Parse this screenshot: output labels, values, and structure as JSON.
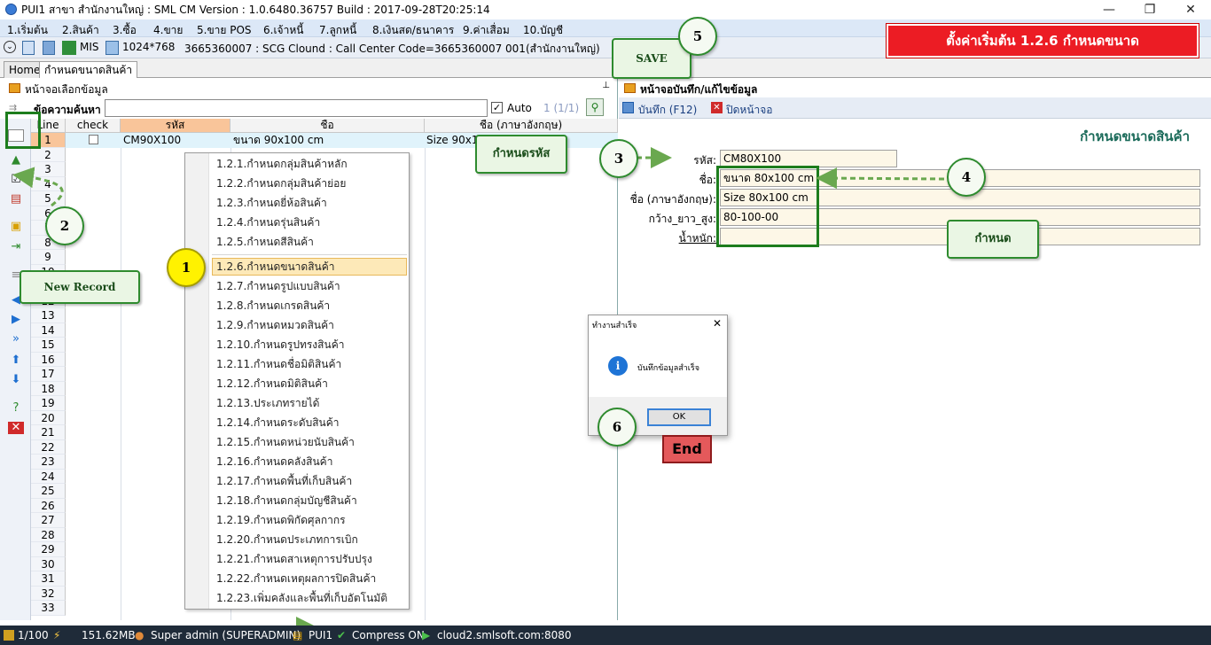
{
  "window": {
    "title": "PUI1 สาขา สำนักงานใหญ่ : SML CM Version : 1.0.6480.36757  Build : 2017-09-28T20:25:14",
    "minimize": "—",
    "maximize": "❐",
    "close": "✕"
  },
  "menu": [
    "1.เริ่มต้น",
    "2.สินค้า",
    "3.ซื้อ",
    "4.ขาย",
    "5.ขาย POS",
    "6.เจ้าหนี้",
    "7.ลูกหนี้",
    "8.เงินสด/ธนาคาร",
    "9.ค่าเสื่อม",
    "10.บัญชี"
  ],
  "toolbar": {
    "mis": "MIS",
    "resolution": "1024*768",
    "info": "3665360007 : SCG Clound : Call Center Code=3665360007 001(สำนักงานใหญ่)"
  },
  "banner": "ตั้งค่าเริ่มต้น 1.2.6 กำหนดขนาด",
  "tabs": [
    "Home",
    "กำหนดขนาดสินค้า"
  ],
  "left_panel": {
    "title": "หน้าจอเลือกข้อมูล",
    "pin": "⊥",
    "search_label": "ข้อความค้นหา",
    "auto_label": "Auto",
    "page_info": "1 (1/1)",
    "columns": [
      "Line",
      "check",
      "รหัส",
      "ชื่อ",
      "ชื่อ (ภาษาอังกฤษ)"
    ],
    "first_row": {
      "code": "CM90X100",
      "name": "ขนาด 90x100  cm",
      "name_en": "Size  90x1"
    },
    "row_numbers": [
      "1",
      "2",
      "3",
      "4",
      "5",
      "6",
      "7",
      "8",
      "9",
      "10",
      "11",
      "12",
      "13",
      "14",
      "15",
      "16",
      "17",
      "18",
      "19",
      "20",
      "21",
      "22",
      "23",
      "24",
      "25",
      "26",
      "27",
      "28",
      "29",
      "30",
      "31",
      "32",
      "33"
    ]
  },
  "popup_menu": [
    "1.2.1.กำหนดกลุ่มสินค้าหลัก",
    "1.2.2.กำหนดกลุ่มสินค้าย่อย",
    "1.2.3.กำหนดยี่ห้อสินค้า",
    "1.2.4.กำหนดรุ่นสินค้า",
    "1.2.5.กำหนดสีสินค้า",
    "1.2.6.กำหนดขนาดสินค้า",
    "1.2.7.กำหนดรูปแบบสินค้า",
    "1.2.8.กำหนดเกรดสินค้า",
    "1.2.9.กำหนดหมวดสินค้า",
    "1.2.10.กำหนดรูปทรงสินค้า",
    "1.2.11.กำหนดชื่อมิติสินค้า",
    "1.2.12.กำหนดมิติสินค้า",
    "1.2.13.ประเภทรายได้",
    "1.2.14.กำหนดระดับสินค้า",
    "1.2.15.กำหนดหน่วยนับสินค้า",
    "1.2.16.กำหนดคลังสินค้า",
    "1.2.17.กำหนดพื้นที่เก็บสินค้า",
    "1.2.18.กำหนดกลุ่มบัญชีสินค้า",
    "1.2.19.กำหนดพิกัดศุลกากร",
    "1.2.20.กำหนดประเภทการเบิก",
    "1.2.21.กำหนดสาเหตุการปรับปรุง",
    "1.2.22.กำหนดเหตุผลการปิดสินค้า",
    "1.2.23.เพิ่มคลังและพื้นที่เก็บอัตโนมัติ"
  ],
  "right_panel": {
    "title": "หน้าจอบันทึก/แก้ไขข้อมูล",
    "save": "บันทึก (F12)",
    "close": "ปิดหน้าจอ",
    "form_title": "กำหนดขนาดสินค้า",
    "fields": [
      {
        "label": "รหัส:",
        "value": "CM80X100"
      },
      {
        "label": "ชื่อ:",
        "value": "ขนาด 80x100  cm"
      },
      {
        "label": "ชื่อ (ภาษาอังกฤษ):",
        "value": "Size  80x100  cm"
      },
      {
        "label": "กว้าง_ยาว_สูง:",
        "value": "80-100-00"
      },
      {
        "label": "น้ำหนัก:",
        "value": ""
      }
    ]
  },
  "dialog": {
    "title": "ทำงานสำเร็จ",
    "message": "บันทึกข้อมูลสำเร็จ",
    "ok": "OK",
    "close": "✕"
  },
  "end_button": "End",
  "callouts": {
    "new_record": "New Record",
    "save": "SAVE",
    "code": "กำหนดรหัส",
    "define": "กำหนด"
  },
  "steps": [
    "1",
    "2",
    "3",
    "4",
    "5",
    "6"
  ],
  "status": {
    "records": "1/100",
    "memory": "151.62MB",
    "user": "Super admin (SUPERADMIN)",
    "branch": "PUI1",
    "compress": "Compress ON",
    "server": "cloud2.smlsoft.com:8080"
  }
}
